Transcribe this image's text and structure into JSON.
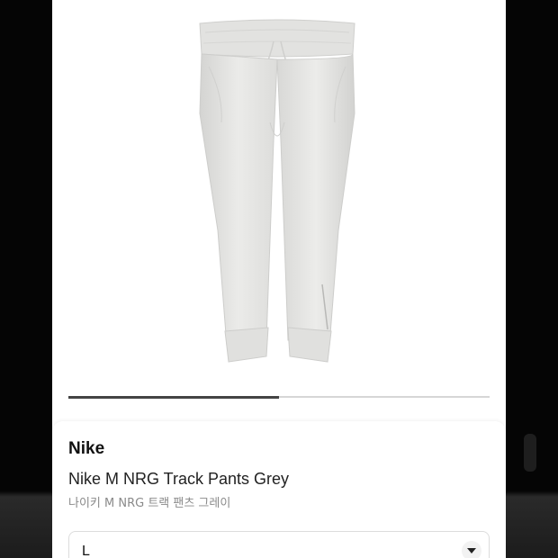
{
  "product": {
    "brand": "Nike",
    "name": "Nike M NRG Track Pants Grey",
    "name_ko": "나이키 M NRG 트랙 팬츠 그레이",
    "image_icon": "track-pants-image"
  },
  "gallery": {
    "progress": 0.5
  },
  "size_selector": {
    "selected": "L",
    "icon": "chevron-down-icon"
  },
  "colors": {
    "pants": "#e6e6e4",
    "background": "#ffffff",
    "progress_fill": "#444444"
  }
}
